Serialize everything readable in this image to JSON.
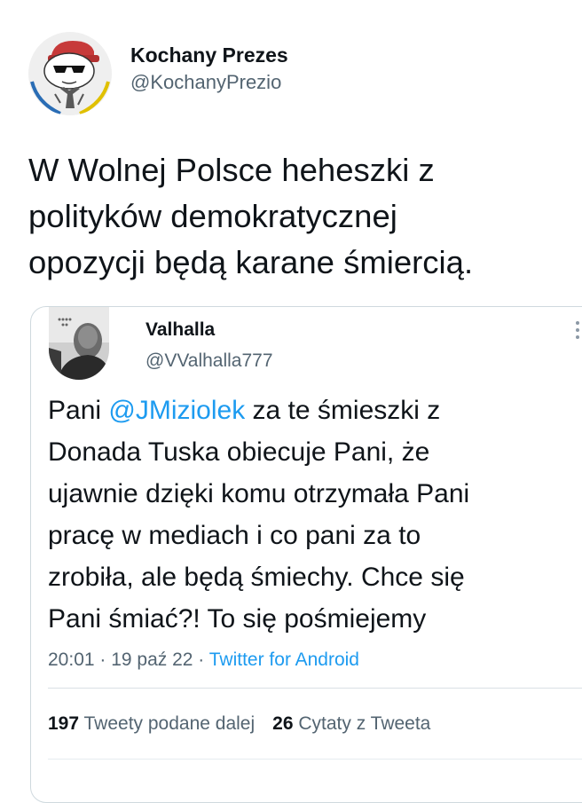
{
  "author": {
    "name": "Kochany Prezes",
    "handle": "@KochanyPrezio"
  },
  "tweet": {
    "lines": [
      "W Wolnej Polsce heheszki z",
      "polityków demokratycznej",
      "opozycji będą karane śmiercią."
    ]
  },
  "quoted": {
    "name": "Valhalla",
    "handle": "@VValhalla777",
    "text": {
      "line1_prefix": "Pani ",
      "mention": "@JMiziolek",
      "line1_suffix": " za te śmieszki z",
      "line2": "Donada Tuska obiecuje Pani, że",
      "line3": "ujawnie dzięki komu otrzymała Pani",
      "line4": "pracę w mediach i co pani za to",
      "line5": "zrobiła, ale będą śmiechy. Chce się",
      "line6": "Pani śmiać?! To się pośmiejemy"
    },
    "meta": {
      "timestamp": "20:01 · 19 paź 22 · ",
      "source": "Twitter for Android"
    },
    "stats": {
      "retweets_count": "197",
      "retweets_label": " Tweety podane dalej",
      "quotes_count": "26",
      "quotes_label": " Cytaty z Tweeta"
    }
  },
  "colors": {
    "link": "#1d9bf0",
    "secondary_text": "#536471",
    "border": "#cfd9de"
  },
  "icons": {
    "author_avatar": "cartoon-avatar-icon",
    "quoted_avatar": "user-photo-icon",
    "more": "more-options-icon"
  }
}
